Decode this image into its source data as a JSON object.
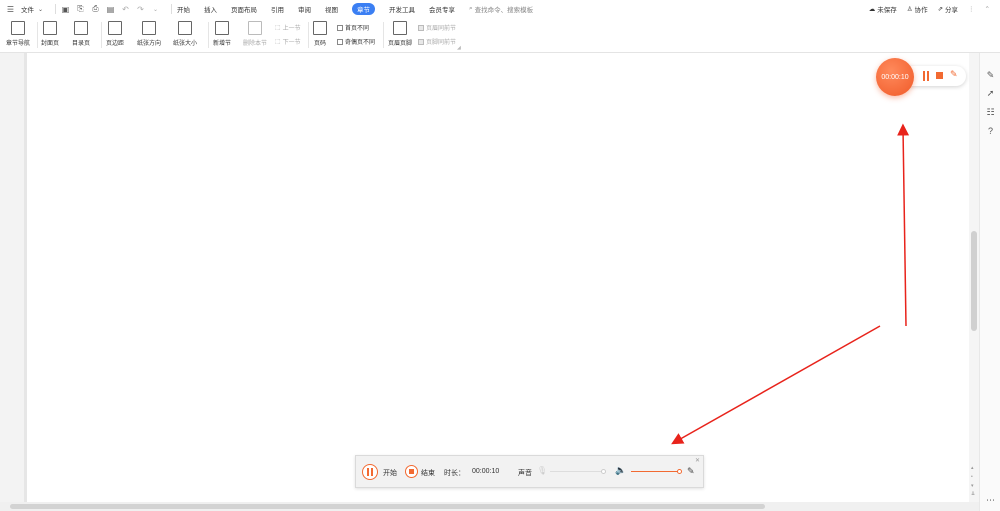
{
  "menubar": {
    "file_label": "文件",
    "tabs": [
      "开始",
      "插入",
      "页面布局",
      "引用",
      "审阅",
      "视图",
      "章节",
      "开发工具",
      "会员专享"
    ],
    "active_tab": "章节",
    "search_placeholder": "查找命令、搜索模板",
    "unsaved": "未保存",
    "collab": "协作",
    "share": "分享"
  },
  "ribbon": {
    "chapter_nav": "章节导航",
    "cover_page": "封面页",
    "toc_page": "目录页",
    "margins": "页边距",
    "orientation": "纸张方向",
    "paper_size": "纸张大小",
    "new_section": "新增节",
    "delete_section": "删除本节",
    "prev_section": "上一节",
    "next_section": "下一节",
    "page_number": "页码",
    "first_page_diff": "首页不同",
    "odd_even_diff": "奇偶页不同",
    "header_footer": "页眉页脚",
    "header_same_prev": "页眉同前节",
    "footer_same_prev": "页脚同前节"
  },
  "float_recorder": {
    "time": "00:00:10"
  },
  "recorder_bar": {
    "start_label": "开始",
    "stop_label": "结束",
    "duration_label": "时长：",
    "duration_value": "00:00:10",
    "sound_label": "声音"
  },
  "colors": {
    "accent": "#f26a32",
    "tab_active": "#3b7ff3",
    "arrow": "#e8231b"
  }
}
